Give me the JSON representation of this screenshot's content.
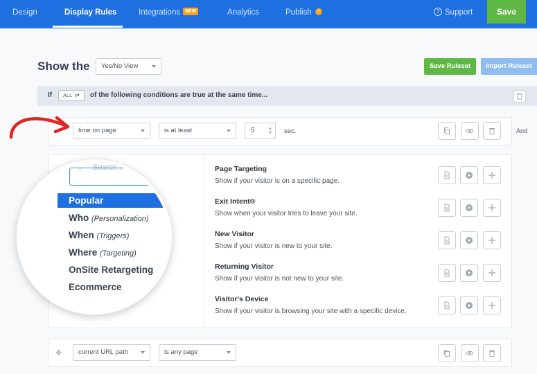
{
  "nav": {
    "tabs": [
      {
        "label": "Design"
      },
      {
        "label": "Display Rules"
      },
      {
        "label": "Integrations",
        "badge": "NEW"
      },
      {
        "label": "Analytics"
      },
      {
        "label": "Publish",
        "badge": "!"
      }
    ],
    "active_tab": "Display Rules",
    "support": "Support",
    "save": "Save"
  },
  "header": {
    "show_the": "Show the",
    "view_select": "Yes/No View",
    "save_ruleset": "Save Ruleset",
    "import_ruleset": "Import Ruleset"
  },
  "conditions": {
    "if": "If",
    "match": "ALL",
    "text": "of the following conditions are true at the same time..."
  },
  "rule1": {
    "field": "time on page",
    "operator": "is at least",
    "value": "5",
    "unit": "sec.",
    "joiner": "And"
  },
  "picker": {
    "search_placeholder": "Search...",
    "categories": [
      {
        "label": "Popular",
        "sub": ""
      },
      {
        "label": "Who",
        "sub": "(Personalization)"
      },
      {
        "label": "When",
        "sub": "(Triggers)"
      },
      {
        "label": "Where",
        "sub": "(Targeting)"
      },
      {
        "label": "OnSite Retargeting",
        "sub": ""
      },
      {
        "label": "Ecommerce",
        "sub": ""
      }
    ],
    "options": [
      {
        "title": "Page Targeting",
        "desc": "Show if your visitor is on a specific page."
      },
      {
        "title": "Exit Intent®",
        "desc": "Show when your visitor tries to leave your site."
      },
      {
        "title": "New Visitor",
        "desc": "Show if your visitor is new to your site."
      },
      {
        "title": "Returning Visitor",
        "desc": "Show if your visitor is not new to your site."
      },
      {
        "title": "Visitor's Device",
        "desc": "Show if your visitor is browsing your site with a specific device."
      }
    ]
  },
  "rule2": {
    "field": "current URL path",
    "operator": "is any page"
  },
  "colors": {
    "nav_blue": "#1e6fe0",
    "green": "#5fb846",
    "light_blue": "#8fbdf0",
    "badge_orange": "#f6a21b",
    "annotation_red": "#e02424"
  }
}
